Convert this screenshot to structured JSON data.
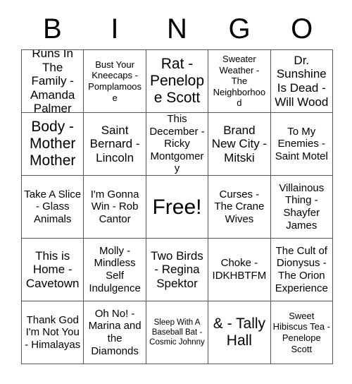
{
  "card": {
    "title": "BINGO",
    "header_letters": [
      "B",
      "I",
      "N",
      "G",
      "O"
    ],
    "colors": {
      "text": "#000000",
      "grid_line": "#555555",
      "background": "#ffffff"
    },
    "rows": [
      [
        {
          "text": "Runs In The Family - Amanda Palmer",
          "size": "l"
        },
        {
          "text": "Bust Your Kneecaps - Pomplamoose",
          "size": "s"
        },
        {
          "text": "Rat - Penelope Scott",
          "size": "xl"
        },
        {
          "text": "Sweater Weather - The Neighborhood",
          "size": "s"
        },
        {
          "text": "Dr. Sunshine Is Dead - Will Wood",
          "size": "l"
        }
      ],
      [
        {
          "text": "Body - Mother Mother",
          "size": "xl"
        },
        {
          "text": "Saint Bernard - Lincoln",
          "size": "l"
        },
        {
          "text": "This December - Ricky Montgomery",
          "size": "m"
        },
        {
          "text": "Brand New City - Mitski",
          "size": "l"
        },
        {
          "text": "To My Enemies - Saint Motel",
          "size": "m"
        }
      ],
      [
        {
          "text": "Take A Slice - Glass Animals",
          "size": "m"
        },
        {
          "text": "I'm Gonna Win - Rob Cantor",
          "size": "m"
        },
        {
          "text": "Free!",
          "size": "xxl"
        },
        {
          "text": "Curses - The Crane Wives",
          "size": "m"
        },
        {
          "text": "Villainous Thing - Shayfer James",
          "size": "m"
        }
      ],
      [
        {
          "text": "This is Home - Cavetown",
          "size": "l"
        },
        {
          "text": "Molly - Mindless Self Indulgence",
          "size": "m"
        },
        {
          "text": "Two Birds - Regina Spektor",
          "size": "l"
        },
        {
          "text": "Choke - IDKHBTFM",
          "size": "m"
        },
        {
          "text": "The Cult of Dionysus - The Orion Experience",
          "size": "m"
        }
      ],
      [
        {
          "text": "Thank God I'm Not You - Himalayas",
          "size": "m"
        },
        {
          "text": "Oh No! - Marina and the Diamonds",
          "size": "m"
        },
        {
          "text": "Sleep With A Baseball Bat - Cosmic Johnny",
          "size": "xs"
        },
        {
          "text": "& - Tally Hall",
          "size": "xl"
        },
        {
          "text": "Sweet Hibiscus Tea - Penelope Scott",
          "size": "s"
        }
      ]
    ]
  }
}
